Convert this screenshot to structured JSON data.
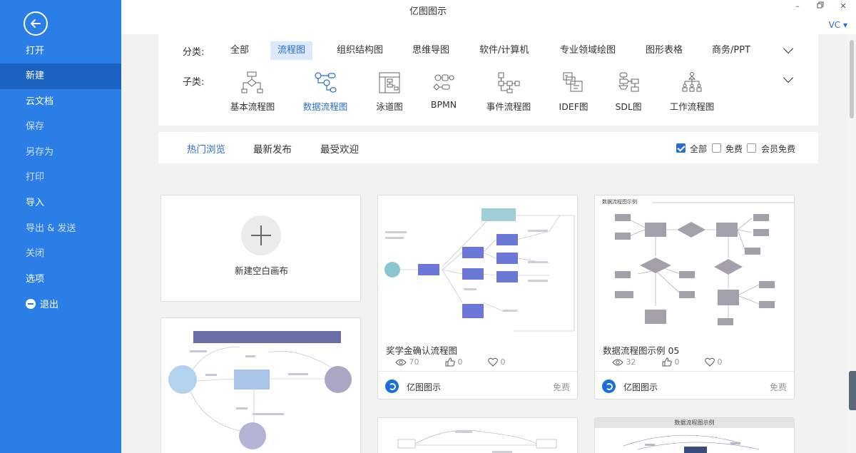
{
  "window": {
    "title": "亿图图示",
    "user": "VC ▾"
  },
  "sidebar": {
    "items": [
      {
        "label": "打开",
        "state": "normal"
      },
      {
        "label": "新建",
        "state": "active"
      },
      {
        "label": "云文档",
        "state": "normal"
      },
      {
        "label": "保存",
        "state": "dim"
      },
      {
        "label": "另存为",
        "state": "dim"
      },
      {
        "label": "打印",
        "state": "dim"
      },
      {
        "label": "导入",
        "state": "normal"
      },
      {
        "label": "导出 & 发送",
        "state": "dim"
      },
      {
        "label": "关闭",
        "state": "dim"
      },
      {
        "label": "选项",
        "state": "normal"
      },
      {
        "label": "退出",
        "state": "normal"
      }
    ]
  },
  "categories": {
    "label": "分类:",
    "items": [
      "全部",
      "流程图",
      "组织结构图",
      "思维导图",
      "软件/计算机",
      "专业领域绘图",
      "图形表格",
      "商务/PPT"
    ],
    "selected": "流程图"
  },
  "subcategories": {
    "label": "子类:",
    "items": [
      {
        "label": "基本流程图",
        "icon": "basic-flowchart-icon"
      },
      {
        "label": "数据流程图",
        "icon": "data-flow-icon"
      },
      {
        "label": "泳道图",
        "icon": "swimlane-icon"
      },
      {
        "label": "BPMN",
        "icon": "bpmn-icon"
      },
      {
        "label": "事件流程图",
        "icon": "event-flow-icon"
      },
      {
        "label": "IDEF图",
        "icon": "idef-icon"
      },
      {
        "label": "SDL图",
        "icon": "sdl-icon"
      },
      {
        "label": "工作流程图",
        "icon": "workflow-icon"
      }
    ],
    "selected": "数据流程图"
  },
  "tabs": {
    "items": [
      "热门浏览",
      "最新发布",
      "最受欢迎"
    ],
    "selected": "热门浏览"
  },
  "filters": [
    {
      "label": "全部",
      "checked": true
    },
    {
      "label": "免费",
      "checked": false
    },
    {
      "label": "会员免费",
      "checked": false
    }
  ],
  "blank_card": {
    "label": "新建空白画布"
  },
  "templates": [
    {
      "title": "奖学金确认流程图",
      "views": "70",
      "likes": "0",
      "favorites": "0",
      "brand": "亿图图示",
      "price": "免费"
    },
    {
      "title": "数据流程图示例 05",
      "thumb_title": "数据流程图示例",
      "views": "32",
      "likes": "0",
      "favorites": "0",
      "brand": "亿图图示",
      "price": "免费"
    }
  ],
  "partial_cards": {
    "card5_title": "数据流程图示例"
  },
  "colors": {
    "sidebar": "#2a7ee5",
    "sidebar_active": "#1a63c0",
    "accent": "#2a6dd0",
    "diagram_blue": "#6b78d6",
    "diagram_gray": "#a3a0ab"
  }
}
